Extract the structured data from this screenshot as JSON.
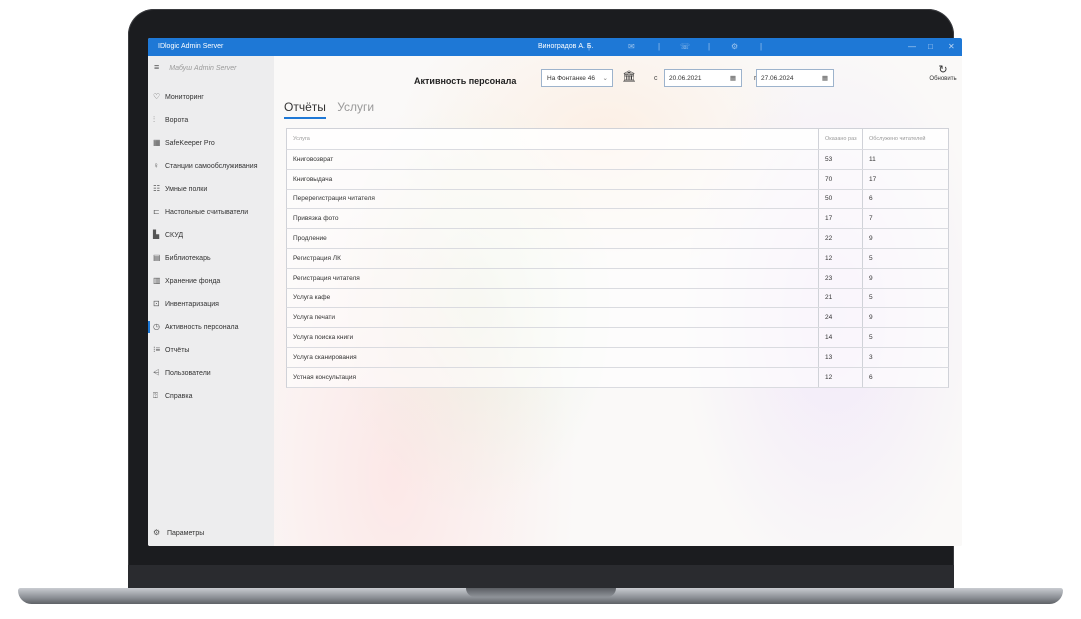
{
  "window": {
    "app_title": "IDlogic Admin Server",
    "user": "Виноградов А. Б."
  },
  "sidebar": {
    "header": "Мабуш Admin Server",
    "items": [
      {
        "label": "Мониторинг",
        "icon": "monitor-icon",
        "glyph": "♡"
      },
      {
        "label": "Ворота",
        "icon": "gate-icon",
        "glyph": "⫶"
      },
      {
        "label": "SafeKeeper Pro",
        "icon": "safe-icon",
        "glyph": "▦"
      },
      {
        "label": "Станции самообслуживания",
        "icon": "kiosk-icon",
        "glyph": "♀"
      },
      {
        "label": "Умные полки",
        "icon": "shelf-icon",
        "glyph": "☷"
      },
      {
        "label": "Настольные считыватели",
        "icon": "reader-icon",
        "glyph": "⊏"
      },
      {
        "label": "СКУД",
        "icon": "access-control-icon",
        "glyph": "▙"
      },
      {
        "label": "Библиотекарь",
        "icon": "librarian-icon",
        "glyph": "▤"
      },
      {
        "label": "Хранение фонда",
        "icon": "storage-icon",
        "glyph": "▥"
      },
      {
        "label": "Инвентаризация",
        "icon": "inventory-icon",
        "glyph": "⊡"
      },
      {
        "label": "Активность персонала",
        "icon": "activity-icon",
        "glyph": "◷"
      },
      {
        "label": "Отчёты",
        "icon": "reports-icon",
        "glyph": "⁝≡"
      },
      {
        "label": "Пользователи",
        "icon": "users-icon",
        "glyph": "⩤"
      },
      {
        "label": "Справка",
        "icon": "help-icon",
        "glyph": "⍰"
      }
    ],
    "settings_label": "Параметры"
  },
  "header": {
    "title": "Активность персонала",
    "location": "На Фонтанке 46",
    "from_label": "с",
    "from_date": "20.06.2021",
    "to_label": "по",
    "to_date": "27.06.2024",
    "refresh_label": "Обновить"
  },
  "tabs": [
    {
      "label": "Отчёты",
      "active": true
    },
    {
      "label": "Услуги",
      "active": false
    }
  ],
  "table": {
    "columns": [
      "Услуга",
      "Оказано раз",
      "Обслужено читателей"
    ],
    "rows": [
      [
        "Книговозврат",
        "53",
        "11"
      ],
      [
        "Книговыдача",
        "70",
        "17"
      ],
      [
        "Перерегистрация читателя",
        "50",
        "6"
      ],
      [
        "Привязка фото",
        "17",
        "7"
      ],
      [
        "Продление",
        "22",
        "9"
      ],
      [
        "Регистрация ЛК",
        "12",
        "5"
      ],
      [
        "Регистрация читателя",
        "23",
        "9"
      ],
      [
        "Услуга кафе",
        "21",
        "5"
      ],
      [
        "Услуга печати",
        "24",
        "9"
      ],
      [
        "Услуга поиска книги",
        "14",
        "5"
      ],
      [
        "Услуга сканирования",
        "13",
        "3"
      ],
      [
        "Устная консультация",
        "12",
        "6"
      ]
    ]
  },
  "colors": {
    "accent": "#1e78d6",
    "sidebar_bg": "#ededee"
  }
}
